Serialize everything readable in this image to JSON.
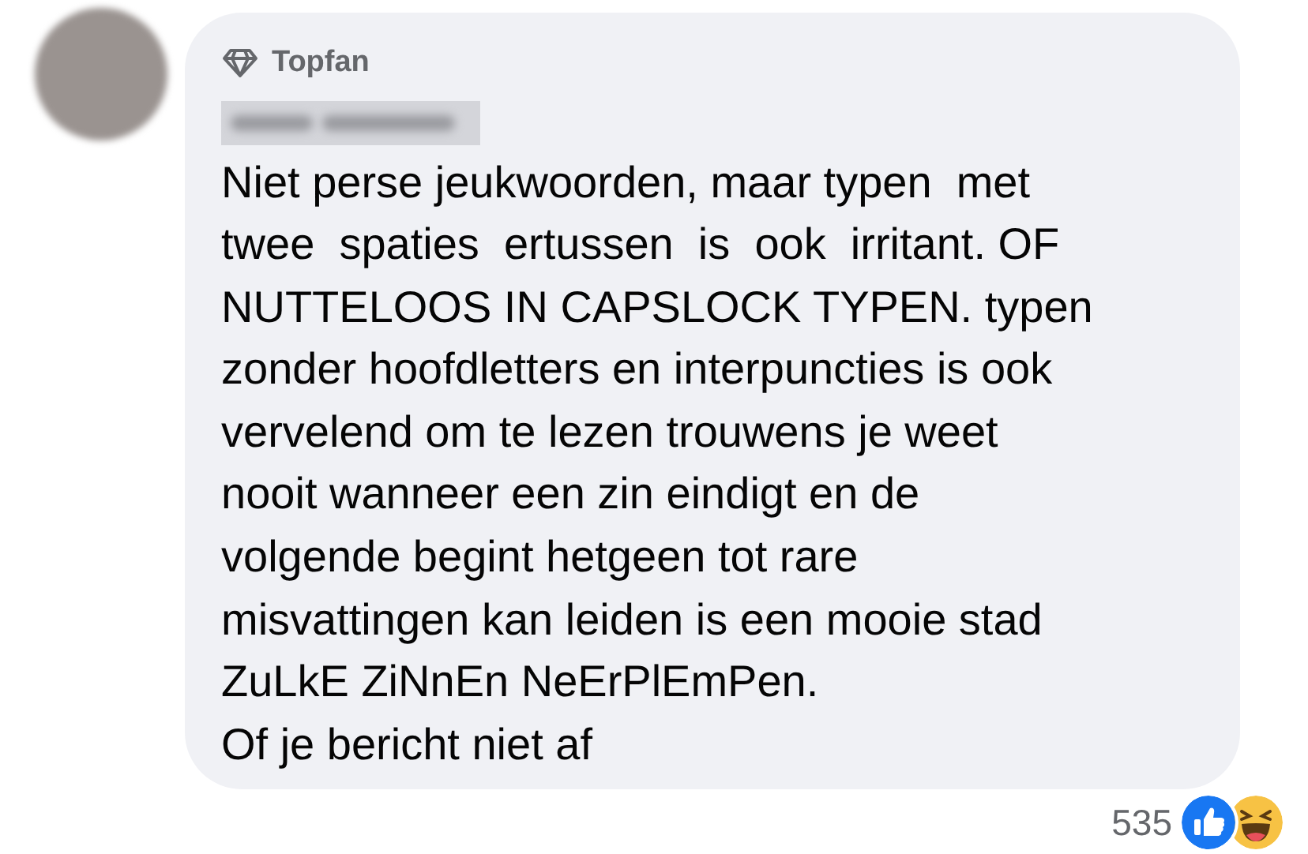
{
  "comment": {
    "badge": "Topfan",
    "body_lines": [
      "Niet perse jeukwoorden, maar typen  met",
      "twee  spaties  ertussen  is  ook  irritant. OF",
      "NUTTELOOS IN CAPSLOCK TYPEN. typen",
      "zonder hoofdletters en interpuncties is ook",
      "vervelend om te lezen trouwens je weet",
      "nooit wanneer een zin eindigt en de",
      "volgende begint hetgeen tot rare",
      "misvattingen kan leiden is een mooie stad",
      "ZuLkE ZiNnEn NeErPlEmPen.",
      "Of je bericht niet af"
    ],
    "reactions": {
      "count": "535",
      "icons": [
        {
          "kind": "like"
        },
        {
          "kind": "haha"
        }
      ]
    }
  }
}
